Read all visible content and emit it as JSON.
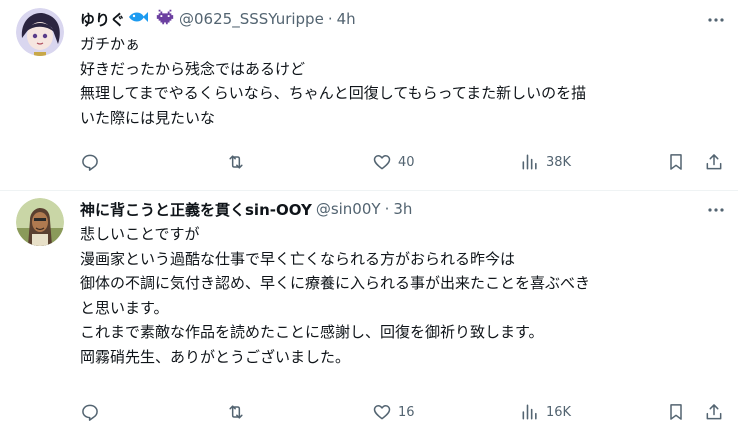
{
  "tweets": [
    {
      "author_name": "ゆりぐ",
      "name_emojis": [
        "fish-emoji",
        "space-invader-emoji"
      ],
      "handle": "@0625_SSSYurippe",
      "time": "4h",
      "lines": [
        "ガチかぁ",
        "好きだったから残念ではあるけど",
        "無理してまでやるくらいなら、ちゃんと回復してもらってまた新しいのを描",
        "いた際には見たいな"
      ],
      "replies": "",
      "retweets": "",
      "likes": "40",
      "views": "38K"
    },
    {
      "author_name": "神に背こうと正義を貫くsin-OOY",
      "handle": "@sin00Y",
      "time": "3h",
      "lines": [
        "悲しいことですが",
        "漫画家という過酷な仕事で早く亡くなられる方がおられる昨今は",
        "御体の不調に気付き認め、早くに療養に入られる事が出来たことを喜ぶべき",
        "と思います。",
        "これまで素敵な作品を読めたことに感謝し、回復を御祈り致します。",
        "岡霧硝先生、ありがとうございました。"
      ],
      "replies": "",
      "retweets": "",
      "likes": "16",
      "views": "16K"
    }
  ],
  "colors": {
    "text": "#0f1419",
    "secondary": "#536471",
    "divider": "#eff3f4",
    "fish": "#1d9bf0",
    "invader": "#6b3fa0"
  }
}
